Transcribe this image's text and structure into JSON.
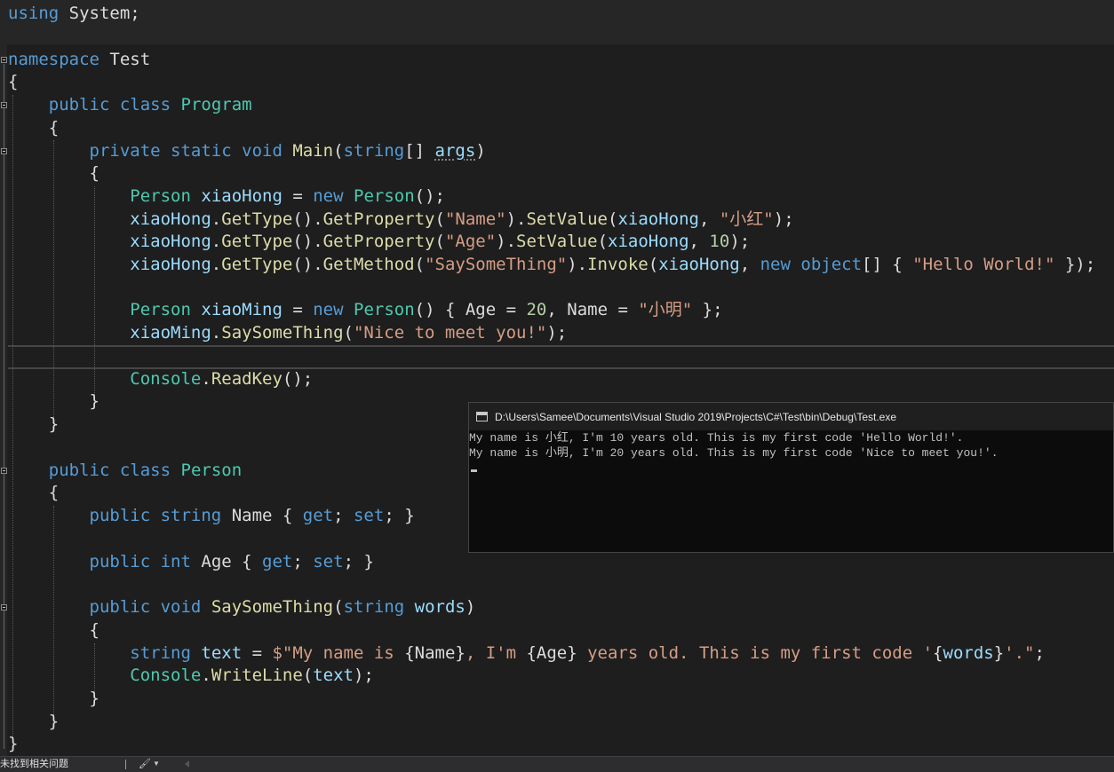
{
  "editor": {
    "lines": [
      {
        "tokens": [
          {
            "c": "kw",
            "t": "using"
          },
          {
            "c": "tx",
            "t": " System;"
          }
        ]
      },
      {
        "tokens": [
          {
            "c": "kw",
            "t": "namespace"
          },
          {
            "c": "tx",
            "t": " Test"
          }
        ]
      },
      {
        "tokens": [
          {
            "c": "tx",
            "t": "{"
          }
        ]
      },
      {
        "tokens": [
          {
            "c": "tx",
            "t": "    "
          },
          {
            "c": "kw",
            "t": "public"
          },
          {
            "c": "tx",
            "t": " "
          },
          {
            "c": "kw",
            "t": "class"
          },
          {
            "c": "tx",
            "t": " "
          },
          {
            "c": "ty",
            "t": "Program"
          }
        ]
      },
      {
        "tokens": [
          {
            "c": "tx",
            "t": "    {"
          }
        ]
      },
      {
        "tokens": [
          {
            "c": "tx",
            "t": "        "
          },
          {
            "c": "kw",
            "t": "private"
          },
          {
            "c": "tx",
            "t": " "
          },
          {
            "c": "kw",
            "t": "static"
          },
          {
            "c": "tx",
            "t": " "
          },
          {
            "c": "kw",
            "t": "void"
          },
          {
            "c": "tx",
            "t": " "
          },
          {
            "c": "fn",
            "t": "Main"
          },
          {
            "c": "tx",
            "t": "("
          },
          {
            "c": "kw",
            "t": "string"
          },
          {
            "c": "tx",
            "t": "[] "
          },
          {
            "c": "lv sq",
            "t": "args"
          },
          {
            "c": "tx",
            "t": ")"
          }
        ]
      },
      {
        "tokens": [
          {
            "c": "tx",
            "t": "        {"
          }
        ]
      },
      {
        "tokens": [
          {
            "c": "tx",
            "t": "            "
          },
          {
            "c": "ty",
            "t": "Person"
          },
          {
            "c": "tx",
            "t": " "
          },
          {
            "c": "lv",
            "t": "xiaoHong"
          },
          {
            "c": "tx",
            "t": " = "
          },
          {
            "c": "kw",
            "t": "new"
          },
          {
            "c": "tx",
            "t": " "
          },
          {
            "c": "ty",
            "t": "Person"
          },
          {
            "c": "tx",
            "t": "();"
          }
        ]
      },
      {
        "tokens": [
          {
            "c": "tx",
            "t": "            "
          },
          {
            "c": "lv",
            "t": "xiaoHong"
          },
          {
            "c": "tx",
            "t": "."
          },
          {
            "c": "fn",
            "t": "GetType"
          },
          {
            "c": "tx",
            "t": "()."
          },
          {
            "c": "fn",
            "t": "GetProperty"
          },
          {
            "c": "tx",
            "t": "("
          },
          {
            "c": "st",
            "t": "\"Name\""
          },
          {
            "c": "tx",
            "t": ")."
          },
          {
            "c": "fn",
            "t": "SetValue"
          },
          {
            "c": "tx",
            "t": "("
          },
          {
            "c": "lv",
            "t": "xiaoHong"
          },
          {
            "c": "tx",
            "t": ", "
          },
          {
            "c": "st",
            "t": "\"小红\""
          },
          {
            "c": "tx",
            "t": ");"
          }
        ]
      },
      {
        "tokens": [
          {
            "c": "tx",
            "t": "            "
          },
          {
            "c": "lv",
            "t": "xiaoHong"
          },
          {
            "c": "tx",
            "t": "."
          },
          {
            "c": "fn",
            "t": "GetType"
          },
          {
            "c": "tx",
            "t": "()."
          },
          {
            "c": "fn",
            "t": "GetProperty"
          },
          {
            "c": "tx",
            "t": "("
          },
          {
            "c": "st",
            "t": "\"Age\""
          },
          {
            "c": "tx",
            "t": ")."
          },
          {
            "c": "fn",
            "t": "SetValue"
          },
          {
            "c": "tx",
            "t": "("
          },
          {
            "c": "lv",
            "t": "xiaoHong"
          },
          {
            "c": "tx",
            "t": ", "
          },
          {
            "c": "nu",
            "t": "10"
          },
          {
            "c": "tx",
            "t": ");"
          }
        ]
      },
      {
        "tokens": [
          {
            "c": "tx",
            "t": "            "
          },
          {
            "c": "lv",
            "t": "xiaoHong"
          },
          {
            "c": "tx",
            "t": "."
          },
          {
            "c": "fn",
            "t": "GetType"
          },
          {
            "c": "tx",
            "t": "()."
          },
          {
            "c": "fn",
            "t": "GetMethod"
          },
          {
            "c": "tx",
            "t": "("
          },
          {
            "c": "st",
            "t": "\"SaySomeThing\""
          },
          {
            "c": "tx",
            "t": ")."
          },
          {
            "c": "fn",
            "t": "Invoke"
          },
          {
            "c": "tx",
            "t": "("
          },
          {
            "c": "lv",
            "t": "xiaoHong"
          },
          {
            "c": "tx",
            "t": ", "
          },
          {
            "c": "kw",
            "t": "new"
          },
          {
            "c": "tx",
            "t": " "
          },
          {
            "c": "kw",
            "t": "object"
          },
          {
            "c": "tx",
            "t": "[] { "
          },
          {
            "c": "st",
            "t": "\"Hello World!\""
          },
          {
            "c": "tx",
            "t": " });"
          }
        ]
      },
      {
        "tokens": []
      },
      {
        "tokens": [
          {
            "c": "tx",
            "t": "            "
          },
          {
            "c": "ty",
            "t": "Person"
          },
          {
            "c": "tx",
            "t": " "
          },
          {
            "c": "lv",
            "t": "xiaoMing"
          },
          {
            "c": "tx",
            "t": " = "
          },
          {
            "c": "kw",
            "t": "new"
          },
          {
            "c": "tx",
            "t": " "
          },
          {
            "c": "ty",
            "t": "Person"
          },
          {
            "c": "tx",
            "t": "() { Age = "
          },
          {
            "c": "nu",
            "t": "20"
          },
          {
            "c": "tx",
            "t": ", Name = "
          },
          {
            "c": "st",
            "t": "\"小明\""
          },
          {
            "c": "tx",
            "t": " };"
          }
        ]
      },
      {
        "tokens": [
          {
            "c": "tx",
            "t": "            "
          },
          {
            "c": "lv",
            "t": "xiaoMing"
          },
          {
            "c": "tx",
            "t": "."
          },
          {
            "c": "fn",
            "t": "SaySomeThing"
          },
          {
            "c": "tx",
            "t": "("
          },
          {
            "c": "st",
            "t": "\"Nice to meet you!\""
          },
          {
            "c": "tx",
            "t": ");"
          }
        ]
      },
      {
        "tokens": []
      },
      {
        "tokens": [
          {
            "c": "tx",
            "t": "            "
          },
          {
            "c": "ty",
            "t": "Console"
          },
          {
            "c": "tx",
            "t": "."
          },
          {
            "c": "fn",
            "t": "ReadKey"
          },
          {
            "c": "tx",
            "t": "();"
          }
        ]
      },
      {
        "tokens": [
          {
            "c": "tx",
            "t": "        }"
          }
        ]
      },
      {
        "tokens": [
          {
            "c": "tx",
            "t": "    }"
          }
        ]
      },
      {
        "tokens": []
      },
      {
        "tokens": [
          {
            "c": "tx",
            "t": "    "
          },
          {
            "c": "kw",
            "t": "public"
          },
          {
            "c": "tx",
            "t": " "
          },
          {
            "c": "kw",
            "t": "class"
          },
          {
            "c": "tx",
            "t": " "
          },
          {
            "c": "ty",
            "t": "Person"
          }
        ]
      },
      {
        "tokens": [
          {
            "c": "tx",
            "t": "    {"
          }
        ]
      },
      {
        "tokens": [
          {
            "c": "tx",
            "t": "        "
          },
          {
            "c": "kw",
            "t": "public"
          },
          {
            "c": "tx",
            "t": " "
          },
          {
            "c": "kw",
            "t": "string"
          },
          {
            "c": "tx",
            "t": " Name { "
          },
          {
            "c": "kw",
            "t": "get"
          },
          {
            "c": "tx",
            "t": "; "
          },
          {
            "c": "kw",
            "t": "set"
          },
          {
            "c": "tx",
            "t": "; }"
          }
        ]
      },
      {
        "tokens": []
      },
      {
        "tokens": [
          {
            "c": "tx",
            "t": "        "
          },
          {
            "c": "kw",
            "t": "public"
          },
          {
            "c": "tx",
            "t": " "
          },
          {
            "c": "kw",
            "t": "int"
          },
          {
            "c": "tx",
            "t": " Age { "
          },
          {
            "c": "kw",
            "t": "get"
          },
          {
            "c": "tx",
            "t": "; "
          },
          {
            "c": "kw",
            "t": "set"
          },
          {
            "c": "tx",
            "t": "; }"
          }
        ]
      },
      {
        "tokens": []
      },
      {
        "tokens": [
          {
            "c": "tx",
            "t": "        "
          },
          {
            "c": "kw",
            "t": "public"
          },
          {
            "c": "tx",
            "t": " "
          },
          {
            "c": "kw",
            "t": "void"
          },
          {
            "c": "tx",
            "t": " "
          },
          {
            "c": "fn",
            "t": "SaySomeThing"
          },
          {
            "c": "tx",
            "t": "("
          },
          {
            "c": "kw",
            "t": "string"
          },
          {
            "c": "tx",
            "t": " "
          },
          {
            "c": "lv",
            "t": "words"
          },
          {
            "c": "tx",
            "t": ")"
          }
        ]
      },
      {
        "tokens": [
          {
            "c": "tx",
            "t": "        {"
          }
        ]
      },
      {
        "tokens": [
          {
            "c": "tx",
            "t": "            "
          },
          {
            "c": "kw",
            "t": "string"
          },
          {
            "c": "tx",
            "t": " "
          },
          {
            "c": "lv",
            "t": "text"
          },
          {
            "c": "tx",
            "t": " = "
          },
          {
            "c": "st",
            "t": "$\"My name is "
          },
          {
            "c": "tx",
            "t": "{Name}"
          },
          {
            "c": "st",
            "t": ", I'm "
          },
          {
            "c": "tx",
            "t": "{Age}"
          },
          {
            "c": "st",
            "t": " years old. This is my first code '"
          },
          {
            "c": "tx",
            "t": "{"
          },
          {
            "c": "lv",
            "t": "words"
          },
          {
            "c": "tx",
            "t": "}"
          },
          {
            "c": "st",
            "t": "'.\""
          },
          {
            "c": "tx",
            "t": ";"
          }
        ]
      },
      {
        "tokens": [
          {
            "c": "tx",
            "t": "            "
          },
          {
            "c": "ty",
            "t": "Console"
          },
          {
            "c": "tx",
            "t": "."
          },
          {
            "c": "fn",
            "t": "WriteLine"
          },
          {
            "c": "tx",
            "t": "("
          },
          {
            "c": "lv",
            "t": "text"
          },
          {
            "c": "tx",
            "t": ");"
          }
        ]
      },
      {
        "tokens": [
          {
            "c": "tx",
            "t": "        }"
          }
        ]
      },
      {
        "tokens": [
          {
            "c": "tx",
            "t": "    }"
          }
        ]
      },
      {
        "tokens": [
          {
            "c": "tx",
            "t": "}"
          }
        ]
      }
    ]
  },
  "console": {
    "title": "D:\\Users\\Samee\\Documents\\Visual Studio 2019\\Projects\\C#\\Test\\bin\\Debug\\Test.exe",
    "output": [
      "My name is 小红, I'm 10 years old. This is my first code 'Hello World!'.",
      "My name is 小明, I'm 20 years old. This is my first code 'Nice to meet you!'."
    ]
  },
  "statusbar": {
    "issues_text": "未找到相关问题",
    "brush_icon": "paintbrush-icon",
    "dropdown_icon": "caret-down-icon",
    "scroll_left_icon": "arrow-left-icon"
  },
  "theme": {
    "keyword": "#569cd6",
    "type": "#4ec9b0",
    "method": "#dcdcaa",
    "string": "#d69d85",
    "number": "#b5cea8",
    "variable": "#9cdcfe",
    "text": "#dcdcdc",
    "background": "#1e1e1e"
  }
}
